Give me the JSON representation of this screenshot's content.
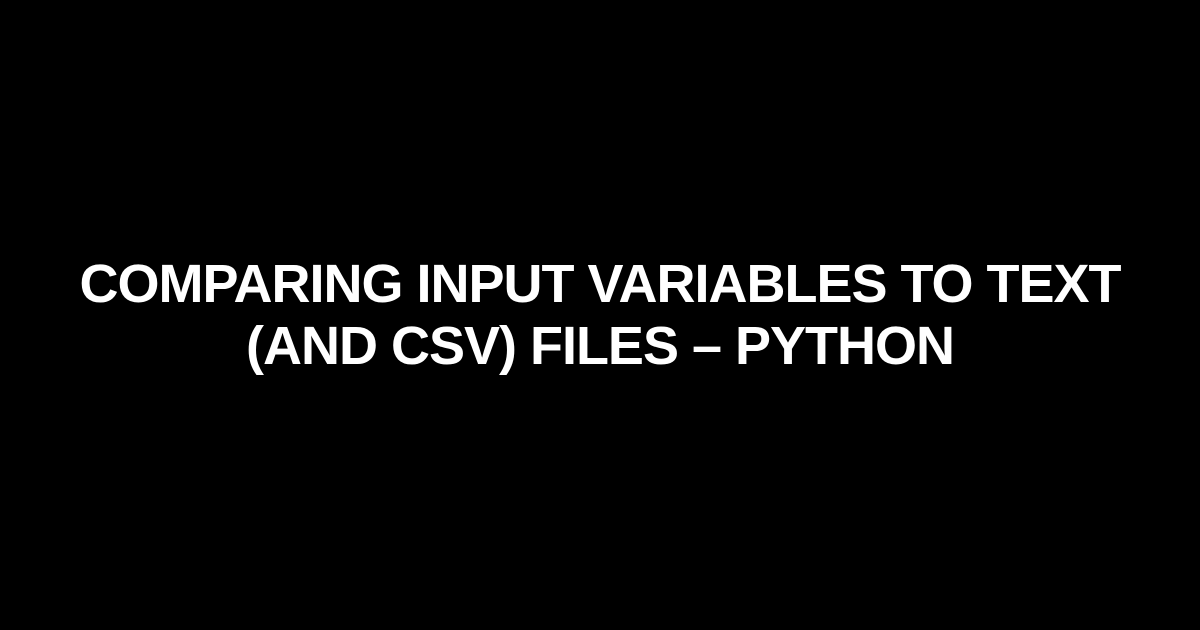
{
  "title": "Comparing input variables to text (and csv) files – Python"
}
